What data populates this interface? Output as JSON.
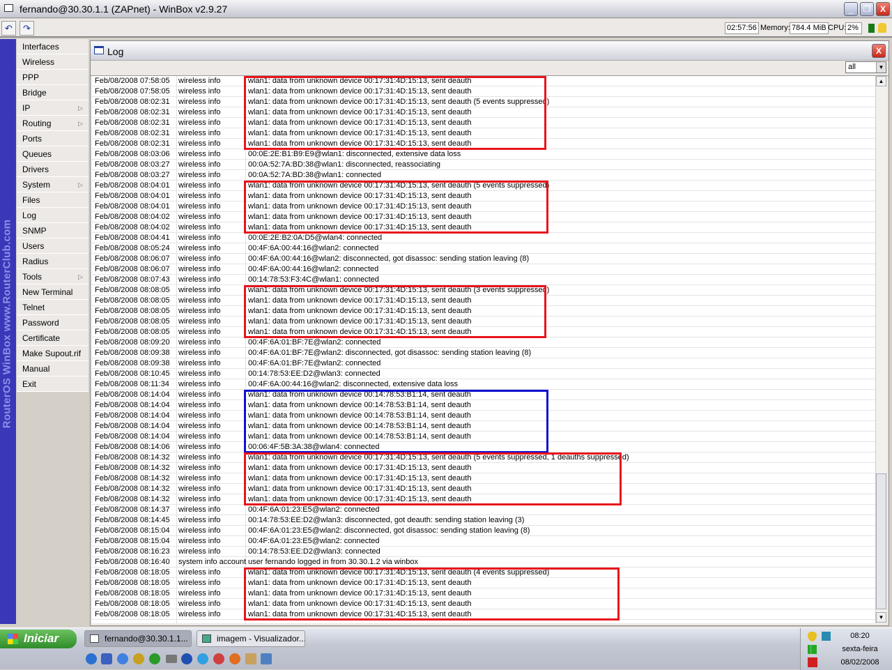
{
  "window": {
    "title": "fernando@30.30.1.1 (ZAPnet) - WinBox v2.9.27"
  },
  "toolbar": {
    "undo_icon": "undo-icon",
    "redo_icon": "redo-icon",
    "uptime": "02:57:56",
    "memory_label": "Memory:",
    "memory": "784.4 MiB",
    "cpu_label": "CPU:",
    "cpu": "2%"
  },
  "sidebar": {
    "brand": "RouterOS WinBox   www.RouterClub.com",
    "items": [
      {
        "label": "Interfaces"
      },
      {
        "label": "Wireless"
      },
      {
        "label": "PPP"
      },
      {
        "label": "Bridge"
      },
      {
        "label": "IP",
        "submenu": true
      },
      {
        "label": "Routing",
        "submenu": true
      },
      {
        "label": "Ports"
      },
      {
        "label": "Queues"
      },
      {
        "label": "Drivers"
      },
      {
        "label": "System",
        "submenu": true
      },
      {
        "label": "Files"
      },
      {
        "label": "Log"
      },
      {
        "label": "SNMP"
      },
      {
        "label": "Users"
      },
      {
        "label": "Radius"
      },
      {
        "label": "Tools",
        "submenu": true
      },
      {
        "label": "New Terminal"
      },
      {
        "label": "Telnet"
      },
      {
        "label": "Password"
      },
      {
        "label": "Certificate"
      },
      {
        "label": "Make Supout.rif"
      },
      {
        "label": "Manual"
      },
      {
        "label": "Exit"
      }
    ]
  },
  "log": {
    "title": "Log",
    "filter": "all",
    "rows": [
      [
        "Feb/08/2008 07:58:05",
        "wireless info",
        "wlan1: data from unknown device 00:17:31:4D:15:13, sent deauth"
      ],
      [
        "Feb/08/2008 07:58:05",
        "wireless info",
        "wlan1: data from unknown device 00:17:31:4D:15:13, sent deauth"
      ],
      [
        "Feb/08/2008 08:02:31",
        "wireless info",
        "wlan1: data from unknown device 00:17:31:4D:15:13, sent deauth (5 events suppressed)"
      ],
      [
        "Feb/08/2008 08:02:31",
        "wireless info",
        "wlan1: data from unknown device 00:17:31:4D:15:13, sent deauth"
      ],
      [
        "Feb/08/2008 08:02:31",
        "wireless info",
        "wlan1: data from unknown device 00:17:31:4D:15:13, sent deauth"
      ],
      [
        "Feb/08/2008 08:02:31",
        "wireless info",
        "wlan1: data from unknown device 00:17:31:4D:15:13, sent deauth"
      ],
      [
        "Feb/08/2008 08:02:31",
        "wireless info",
        "wlan1: data from unknown device 00:17:31:4D:15:13, sent deauth"
      ],
      [
        "Feb/08/2008 08:03:06",
        "wireless info",
        "00:0E:2E:B1:B9:E9@wlan1: disconnected, extensive data loss"
      ],
      [
        "Feb/08/2008 08:03:27",
        "wireless info",
        "00:0A:52:7A:BD:38@wlan1: disconnected, reassociating"
      ],
      [
        "Feb/08/2008 08:03:27",
        "wireless info",
        "00:0A:52:7A:BD:38@wlan1: connected"
      ],
      [
        "Feb/08/2008 08:04:01",
        "wireless info",
        "wlan1: data from unknown device 00:17:31:4D:15:13, sent deauth (5 events suppressed)"
      ],
      [
        "Feb/08/2008 08:04:01",
        "wireless info",
        "wlan1: data from unknown device 00:17:31:4D:15:13, sent deauth"
      ],
      [
        "Feb/08/2008 08:04:01",
        "wireless info",
        "wlan1: data from unknown device 00:17:31:4D:15:13, sent deauth"
      ],
      [
        "Feb/08/2008 08:04:02",
        "wireless info",
        "wlan1: data from unknown device 00:17:31:4D:15:13, sent deauth"
      ],
      [
        "Feb/08/2008 08:04:02",
        "wireless info",
        "wlan1: data from unknown device 00:17:31:4D:15:13, sent deauth"
      ],
      [
        "Feb/08/2008 08:04:41",
        "wireless info",
        "00:0E:2E:B2:0A:D5@wlan4: connected"
      ],
      [
        "Feb/08/2008 08:05:24",
        "wireless info",
        "00:4F:6A:00:44:16@wlan2: connected"
      ],
      [
        "Feb/08/2008 08:06:07",
        "wireless info",
        "00:4F:6A:00:44:16@wlan2: disconnected, got disassoc: sending station leaving (8)"
      ],
      [
        "Feb/08/2008 08:06:07",
        "wireless info",
        "00:4F:6A:00:44:16@wlan2: connected"
      ],
      [
        "Feb/08/2008 08:07:43",
        "wireless info",
        "00:14:78:53:F3:4C@wlan1: connected"
      ],
      [
        "Feb/08/2008 08:08:05",
        "wireless info",
        "wlan1: data from unknown device 00:17:31:4D:15:13, sent deauth (3 events suppressed)"
      ],
      [
        "Feb/08/2008 08:08:05",
        "wireless info",
        "wlan1: data from unknown device 00:17:31:4D:15:13, sent deauth"
      ],
      [
        "Feb/08/2008 08:08:05",
        "wireless info",
        "wlan1: data from unknown device 00:17:31:4D:15:13, sent deauth"
      ],
      [
        "Feb/08/2008 08:08:05",
        "wireless info",
        "wlan1: data from unknown device 00:17:31:4D:15:13, sent deauth"
      ],
      [
        "Feb/08/2008 08:08:05",
        "wireless info",
        "wlan1: data from unknown device 00:17:31:4D:15:13, sent deauth"
      ],
      [
        "Feb/08/2008 08:09:20",
        "wireless info",
        "00:4F:6A:01:BF:7E@wlan2: connected"
      ],
      [
        "Feb/08/2008 08:09:38",
        "wireless info",
        "00:4F:6A:01:BF:7E@wlan2: disconnected, got disassoc: sending station leaving (8)"
      ],
      [
        "Feb/08/2008 08:09:38",
        "wireless info",
        "00:4F:6A:01:BF:7E@wlan2: connected"
      ],
      [
        "Feb/08/2008 08:10:45",
        "wireless info",
        "00:14:78:53:EE:D2@wlan3: connected"
      ],
      [
        "Feb/08/2008 08:11:34",
        "wireless info",
        "00:4F:6A:00:44:16@wlan2: disconnected, extensive data loss"
      ],
      [
        "Feb/08/2008 08:14:04",
        "wireless info",
        "wlan1: data from unknown device 00:14:78:53:B1:14, sent deauth"
      ],
      [
        "Feb/08/2008 08:14:04",
        "wireless info",
        "wlan1: data from unknown device 00:14:78:53:B1:14, sent deauth"
      ],
      [
        "Feb/08/2008 08:14:04",
        "wireless info",
        "wlan1: data from unknown device 00:14:78:53:B1:14, sent deauth"
      ],
      [
        "Feb/08/2008 08:14:04",
        "wireless info",
        "wlan1: data from unknown device 00:14:78:53:B1:14, sent deauth"
      ],
      [
        "Feb/08/2008 08:14:04",
        "wireless info",
        "wlan1: data from unknown device 00:14:78:53:B1:14, sent deauth"
      ],
      [
        "Feb/08/2008 08:14:06",
        "wireless info",
        "00:06:4F:5B:3A:38@wlan4: connected"
      ],
      [
        "Feb/08/2008 08:14:32",
        "wireless info",
        "wlan1: data from unknown device 00:17:31:4D:15:13, sent deauth (5 events suppressed, 1 deauths suppressed)"
      ],
      [
        "Feb/08/2008 08:14:32",
        "wireless info",
        "wlan1: data from unknown device 00:17:31:4D:15:13, sent deauth"
      ],
      [
        "Feb/08/2008 08:14:32",
        "wireless info",
        "wlan1: data from unknown device 00:17:31:4D:15:13, sent deauth"
      ],
      [
        "Feb/08/2008 08:14:32",
        "wireless info",
        "wlan1: data from unknown device 00:17:31:4D:15:13, sent deauth"
      ],
      [
        "Feb/08/2008 08:14:32",
        "wireless info",
        "wlan1: data from unknown device 00:17:31:4D:15:13, sent deauth"
      ],
      [
        "Feb/08/2008 08:14:37",
        "wireless info",
        "00:4F:6A:01:23:E5@wlan2: connected"
      ],
      [
        "Feb/08/2008 08:14:45",
        "wireless info",
        "00:14:78:53:EE:D2@wlan3: disconnected, got deauth: sending station leaving (3)"
      ],
      [
        "Feb/08/2008 08:15:04",
        "wireless info",
        "00:4F:6A:01:23:E5@wlan2: disconnected, got disassoc: sending station leaving (8)"
      ],
      [
        "Feb/08/2008 08:15:04",
        "wireless info",
        "00:4F:6A:01:23:E5@wlan2: connected"
      ],
      [
        "Feb/08/2008 08:16:23",
        "wireless info",
        "00:14:78:53:EE:D2@wlan3: connected"
      ],
      [
        "Feb/08/2008 08:16:40",
        "system info account",
        "user fernando logged in from 30.30.1.2 via winbox"
      ],
      [
        "Feb/08/2008 08:18:05",
        "wireless info",
        "wlan1: data from unknown device 00:17:31:4D:15:13, sent deauth (4 events suppressed)"
      ],
      [
        "Feb/08/2008 08:18:05",
        "wireless info",
        "wlan1: data from unknown device 00:17:31:4D:15:13, sent deauth"
      ],
      [
        "Feb/08/2008 08:18:05",
        "wireless info",
        "wlan1: data from unknown device 00:17:31:4D:15:13, sent deauth"
      ],
      [
        "Feb/08/2008 08:18:05",
        "wireless info",
        "wlan1: data from unknown device 00:17:31:4D:15:13, sent deauth"
      ],
      [
        "Feb/08/2008 08:18:05",
        "wireless info",
        "wlan1: data from unknown device 00:17:31:4D:15:13, sent deauth"
      ]
    ],
    "highlights": [
      {
        "first": 0,
        "last": 6,
        "color": "red"
      },
      {
        "first": 10,
        "last": 14,
        "color": "red"
      },
      {
        "first": 20,
        "last": 24,
        "color": "red"
      },
      {
        "first": 30,
        "last": 35,
        "color": "blue"
      },
      {
        "first": 36,
        "last": 40,
        "color": "red"
      },
      {
        "first": 47,
        "last": 51,
        "color": "red"
      }
    ]
  },
  "taskbar": {
    "start": "Iniciar",
    "tasks": [
      {
        "label": "fernando@30.30.1.1..."
      },
      {
        "label": "imagem - Visualizador..."
      }
    ],
    "clock": {
      "time": "08:20",
      "day": "sexta-feira",
      "date": "08/02/2008"
    }
  }
}
